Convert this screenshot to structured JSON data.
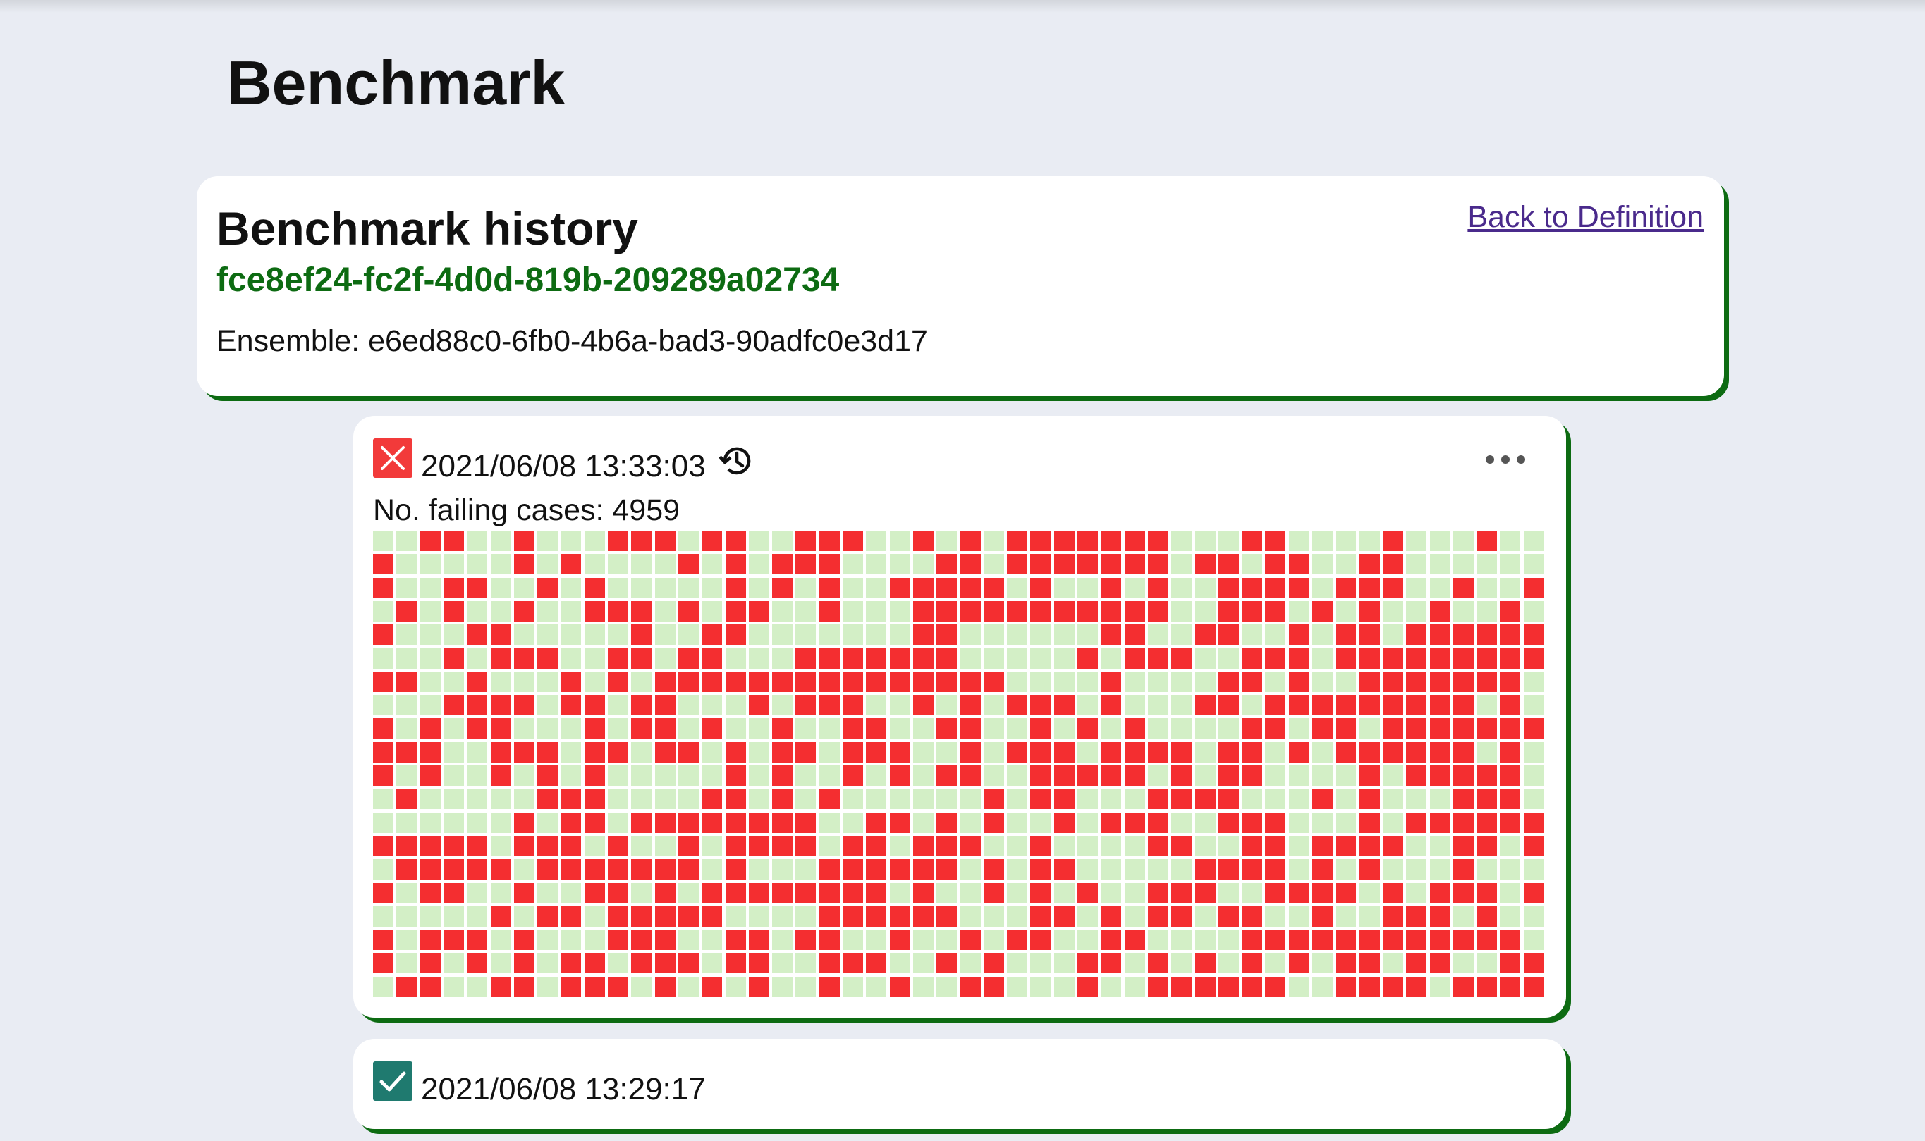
{
  "page": {
    "title": "Benchmark"
  },
  "history": {
    "title": "Benchmark history",
    "benchmark_id": "fce8ef24-fc2f-4d0d-819b-209289a02734",
    "ensemble_label": "Ensemble:",
    "ensemble_id": "e6ed88c0-6fb0-4b6a-bad3-90adfc0e3d17",
    "back_link": "Back to Definition"
  },
  "runs": [
    {
      "status": "failed",
      "status_icon": "x-icon",
      "timestamp": "2021/06/08 13:33:03",
      "action_icon": "history-icon",
      "menu_icon": "more-horizontal-icon",
      "failing_label": "No. failing cases:",
      "failing_count": 4959,
      "grid": {
        "rows": 20,
        "columns": 50,
        "fail_color": "#f42e30",
        "pass_color": "#d3efc6"
      }
    },
    {
      "status": "passed",
      "status_icon": "check-icon",
      "timestamp": "2021/06/08 13:29:17"
    }
  ],
  "colors": {
    "background": "#e9ecf3",
    "card": "#ffffff",
    "accent": "#0d6b12",
    "link": "#4a2a8c",
    "fail": "#f23a3a",
    "pass": "#1f7a6f"
  }
}
